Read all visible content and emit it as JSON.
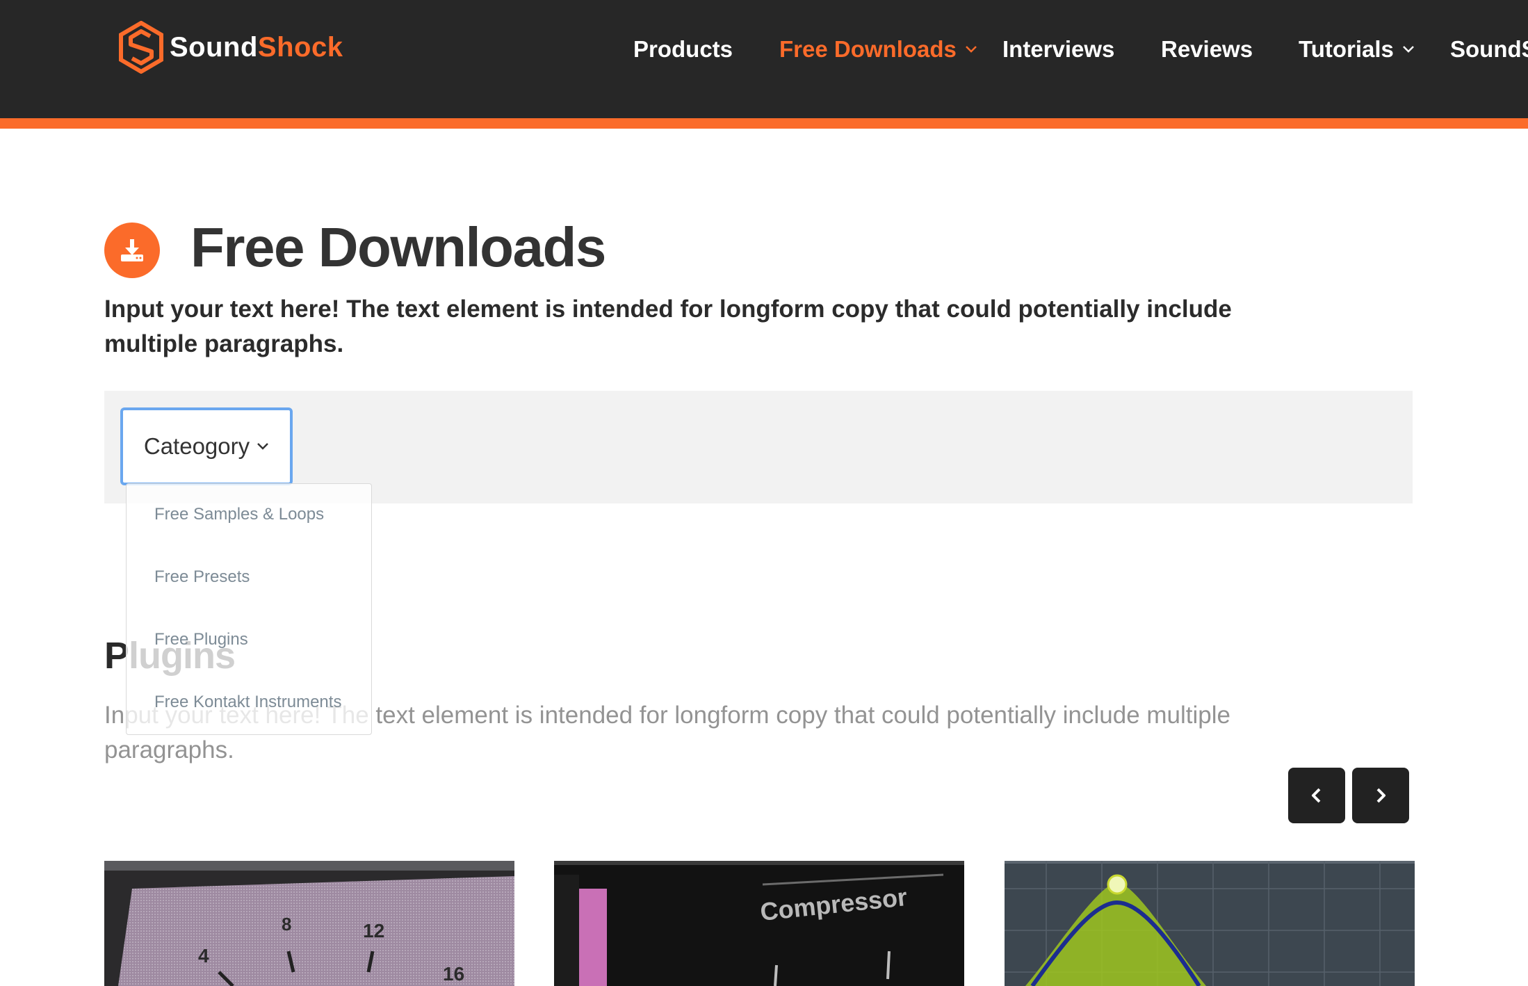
{
  "brand": {
    "name_part1": "Sound",
    "name_part2": "Shock",
    "accent_color": "#fb6b2a",
    "header_bg": "#272727"
  },
  "nav": {
    "items": [
      {
        "label": "Products",
        "active": false,
        "has_dropdown": false
      },
      {
        "label": "Free Downloads",
        "active": true,
        "has_dropdown": true
      },
      {
        "label": "Interviews",
        "active": false,
        "has_dropdown": false
      },
      {
        "label": "Reviews",
        "active": false,
        "has_dropdown": false
      },
      {
        "label": "Tutorials",
        "active": false,
        "has_dropdown": true
      },
      {
        "label": "SoundS",
        "active": false,
        "has_dropdown": false
      }
    ]
  },
  "page": {
    "icon": "download-icon",
    "title": "Free Downloads",
    "intro": "Input your text here! The text element is intended for longform copy that could potentially include multiple paragraphs."
  },
  "filter": {
    "category_label": "Cateogory",
    "options": [
      "Free Samples & Loops",
      "Free Presets",
      "Free Plugins",
      "Free Kontakt Instruments"
    ]
  },
  "section": {
    "title": "Plugins",
    "text": "Input your text here! The text element is intended for longform copy that could potentially include multiple paragraphs."
  },
  "carousel": {
    "prev_icon": "chevron-left-icon",
    "next_icon": "chevron-right-icon"
  },
  "cards": {
    "card1": {
      "dial_labels": [
        "4",
        "8",
        "12",
        "16"
      ]
    },
    "card2": {
      "label": "Compressor"
    },
    "card3": {
      "graphic": "eq-curve"
    }
  }
}
